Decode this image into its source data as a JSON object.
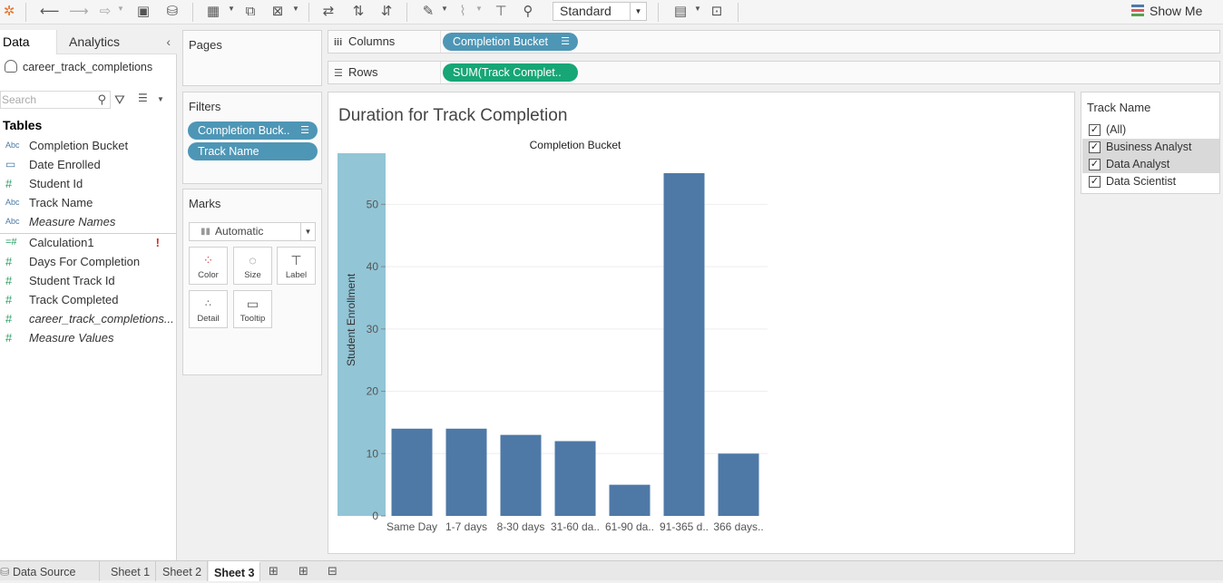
{
  "toolbar": {
    "fit_value": "Standard",
    "show_me_label": "Show Me"
  },
  "data_pane": {
    "tabs": [
      "Data",
      "Analytics"
    ],
    "datasource": "career_track_completions",
    "search_placeholder": "Search",
    "tables_heading": "Tables",
    "dimensions": [
      {
        "type": "Abc",
        "label": "Completion Bucket"
      },
      {
        "type": "calendar",
        "label": "Date Enrolled"
      },
      {
        "type": "#",
        "label": "Student Id"
      },
      {
        "type": "Abc",
        "label": "Track Name"
      },
      {
        "type": "Abc",
        "label": "Measure Names",
        "italic": true
      }
    ],
    "measures": [
      {
        "type": "=#",
        "label": "Calculation1",
        "warning": "!"
      },
      {
        "type": "#",
        "label": "Days For Completion"
      },
      {
        "type": "#",
        "label": "Student Track Id"
      },
      {
        "type": "#",
        "label": "Track Completed"
      },
      {
        "type": "#",
        "label": "career_track_completions...",
        "italic": true
      },
      {
        "type": "#",
        "label": "Measure Values",
        "italic": true
      }
    ]
  },
  "pages": {
    "title": "Pages"
  },
  "filters": {
    "title": "Filters",
    "pills": [
      "Completion Buck..",
      "Track Name"
    ]
  },
  "marks": {
    "title": "Marks",
    "type": "Automatic",
    "buttons": [
      "Color",
      "Size",
      "Label",
      "Detail",
      "Tooltip"
    ]
  },
  "shelves": {
    "columns_label": "Columns",
    "columns_pill": "Completion Bucket",
    "rows_label": "Rows",
    "rows_pill": "SUM(Track Complet.."
  },
  "viz": {
    "title": "Duration for Track Completion"
  },
  "chart_data": {
    "type": "bar",
    "title": "Duration for Track Completion",
    "column_header": "Completion Bucket",
    "ylabel": "Student Enrollment",
    "categories": [
      "Same Day",
      "1-7 days",
      "8-30 days",
      "31-60 da..",
      "61-90 da..",
      "91-365 d..",
      "366 days.."
    ],
    "values": [
      14,
      14,
      13,
      12,
      5,
      55,
      10
    ],
    "ylim": [
      0,
      58
    ],
    "yticks": [
      0,
      10,
      20,
      30,
      40,
      50
    ],
    "bar_color": "#4e79a7",
    "highlight_band_color": "#92c5d6",
    "grid": true
  },
  "track_filter": {
    "title": "Track Name",
    "items": [
      {
        "label": "(All)",
        "checked": true,
        "highlighted": false
      },
      {
        "label": "Business Analyst",
        "checked": true,
        "highlighted": true
      },
      {
        "label": "Data Analyst",
        "checked": true,
        "highlighted": true
      },
      {
        "label": "Data Scientist",
        "checked": true,
        "highlighted": false
      }
    ]
  },
  "bottom_tabs": {
    "data_source": "Data Source",
    "sheets": [
      "Sheet 1",
      "Sheet 2",
      "Sheet 3"
    ],
    "active": "Sheet 3"
  }
}
